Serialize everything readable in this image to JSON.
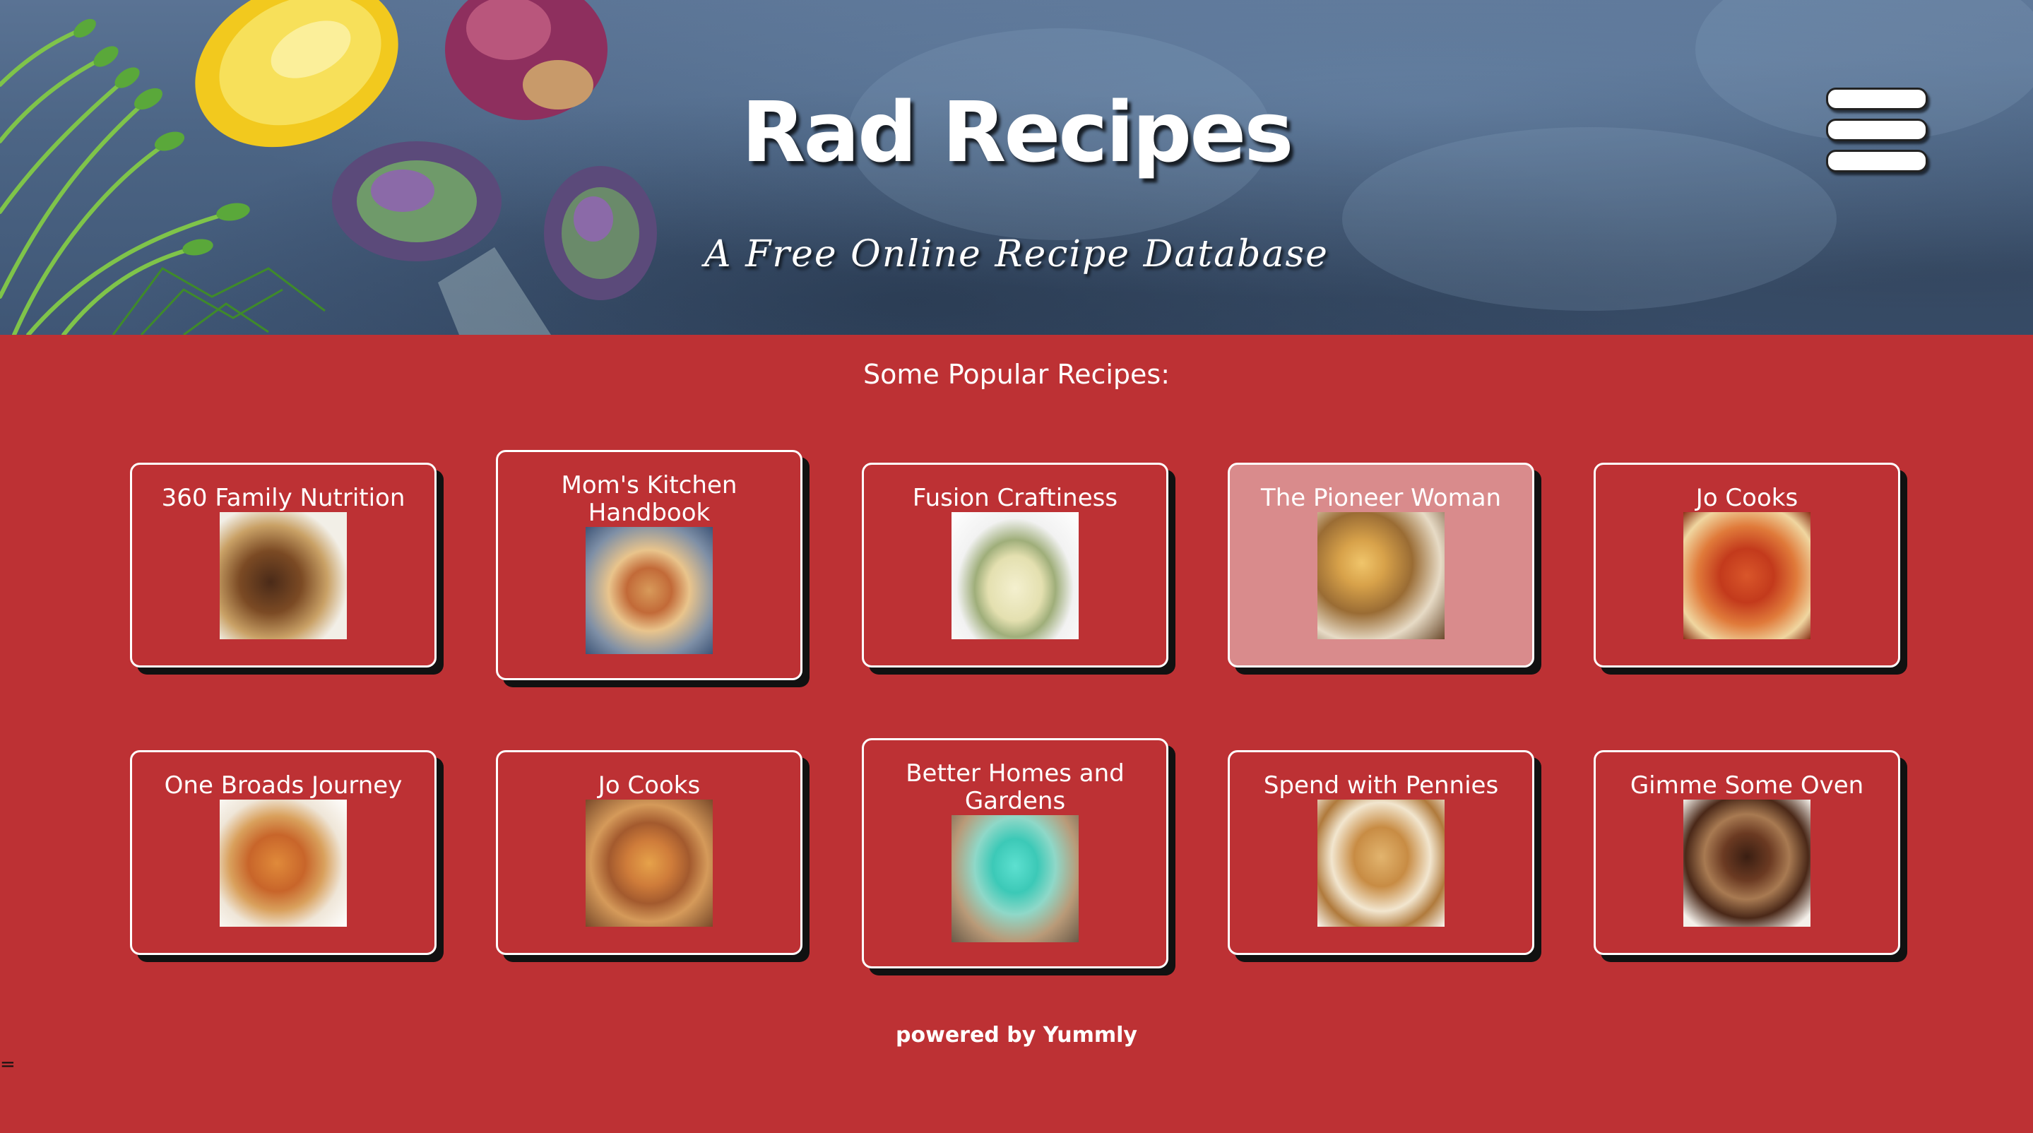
{
  "header": {
    "title": "Rad Recipes",
    "tagline": "A Free Online Recipe Database",
    "menu_icon": "hamburger-menu-icon"
  },
  "main": {
    "heading": "Some Popular Recipes:",
    "cards": [
      {
        "source": "360 Family Nutrition"
      },
      {
        "source": "Mom's Kitchen Handbook"
      },
      {
        "source": "Fusion Craftiness"
      },
      {
        "source": "The Pioneer Woman"
      },
      {
        "source": "Jo Cooks"
      },
      {
        "source": "One Broads Journey"
      },
      {
        "source": "Jo Cooks"
      },
      {
        "source": "Better Homes and Gardens"
      },
      {
        "source": "Spend with Pennies"
      },
      {
        "source": "Gimme Some Oven"
      }
    ]
  },
  "footer": {
    "credit": "powered by Yummly"
  },
  "misc": {
    "stray_mark": "="
  },
  "colors": {
    "page_background": "#bd3134",
    "card_border": "#ffffff",
    "card_hover_background": "#d98b8c",
    "card_shadow": "#111111",
    "text": "#ffffff"
  }
}
